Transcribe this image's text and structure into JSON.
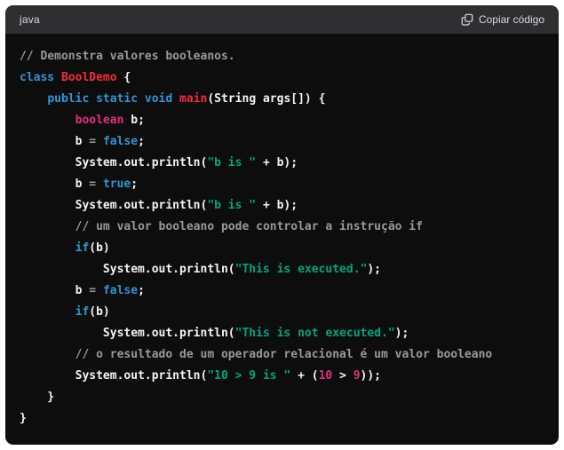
{
  "header": {
    "language": "java",
    "copy_label": "Copiar código",
    "copy_icon": "copy-icon"
  },
  "colors": {
    "block_background": "#0d0d0d",
    "header_background": "#2f2f31",
    "header_text": "#d9d9e3",
    "code_plain": "#f4f4f5",
    "keyword": "#2e95d3",
    "type": "#df3079",
    "title": "#f22c3d",
    "string": "#00a67d",
    "number": "#df3079",
    "comment": "#999999"
  },
  "code": {
    "lines": [
      [
        {
          "c": "com",
          "t": "// Demonstra valores booleanos."
        }
      ],
      [
        {
          "c": "kw",
          "t": "class"
        },
        {
          "c": "plain",
          "t": " "
        },
        {
          "c": "title",
          "t": "BoolDemo"
        },
        {
          "c": "plain",
          "t": " {"
        }
      ],
      [
        {
          "c": "plain",
          "t": "    "
        },
        {
          "c": "kw",
          "t": "public"
        },
        {
          "c": "plain",
          "t": " "
        },
        {
          "c": "kw",
          "t": "static"
        },
        {
          "c": "plain",
          "t": " "
        },
        {
          "c": "kw",
          "t": "void"
        },
        {
          "c": "plain",
          "t": " "
        },
        {
          "c": "title",
          "t": "main"
        },
        {
          "c": "plain",
          "t": "(String args[]) {"
        }
      ],
      [
        {
          "c": "plain",
          "t": "        "
        },
        {
          "c": "type",
          "t": "boolean"
        },
        {
          "c": "plain",
          "t": " b;"
        }
      ],
      [
        {
          "c": "plain",
          "t": "        b "
        },
        {
          "c": "op",
          "t": "="
        },
        {
          "c": "plain",
          "t": " "
        },
        {
          "c": "kw",
          "t": "false"
        },
        {
          "c": "plain",
          "t": ";"
        }
      ],
      [
        {
          "c": "plain",
          "t": "        System.out.println("
        },
        {
          "c": "str",
          "t": "\"b is \""
        },
        {
          "c": "plain",
          "t": " + b);"
        }
      ],
      [
        {
          "c": "plain",
          "t": "        b "
        },
        {
          "c": "op",
          "t": "="
        },
        {
          "c": "plain",
          "t": " "
        },
        {
          "c": "kw",
          "t": "true"
        },
        {
          "c": "plain",
          "t": ";"
        }
      ],
      [
        {
          "c": "plain",
          "t": "        System.out.println("
        },
        {
          "c": "str",
          "t": "\"b is \""
        },
        {
          "c": "plain",
          "t": " + b);"
        }
      ],
      [
        {
          "c": "plain",
          "t": "        "
        },
        {
          "c": "com",
          "t": "// um valor booleano pode controlar a instrução if"
        }
      ],
      [
        {
          "c": "plain",
          "t": "        "
        },
        {
          "c": "kw",
          "t": "if"
        },
        {
          "c": "plain",
          "t": "(b)"
        }
      ],
      [
        {
          "c": "plain",
          "t": "            System.out.println("
        },
        {
          "c": "str",
          "t": "\"This is executed.\""
        },
        {
          "c": "plain",
          "t": ");"
        }
      ],
      [
        {
          "c": "plain",
          "t": "        b "
        },
        {
          "c": "op",
          "t": "="
        },
        {
          "c": "plain",
          "t": " "
        },
        {
          "c": "kw",
          "t": "false"
        },
        {
          "c": "plain",
          "t": ";"
        }
      ],
      [
        {
          "c": "plain",
          "t": "        "
        },
        {
          "c": "kw",
          "t": "if"
        },
        {
          "c": "plain",
          "t": "(b)"
        }
      ],
      [
        {
          "c": "plain",
          "t": "            System.out.println("
        },
        {
          "c": "str",
          "t": "\"This is not executed.\""
        },
        {
          "c": "plain",
          "t": ");"
        }
      ],
      [
        {
          "c": "plain",
          "t": "        "
        },
        {
          "c": "com",
          "t": "// o resultado de um operador relacional é um valor booleano"
        }
      ],
      [
        {
          "c": "plain",
          "t": "        System.out.println("
        },
        {
          "c": "str",
          "t": "\"10 > 9 is \""
        },
        {
          "c": "plain",
          "t": " + ("
        },
        {
          "c": "num",
          "t": "10"
        },
        {
          "c": "plain",
          "t": " > "
        },
        {
          "c": "num",
          "t": "9"
        },
        {
          "c": "plain",
          "t": "));"
        }
      ],
      [
        {
          "c": "plain",
          "t": "    }"
        }
      ],
      [
        {
          "c": "plain",
          "t": "}"
        }
      ]
    ]
  }
}
